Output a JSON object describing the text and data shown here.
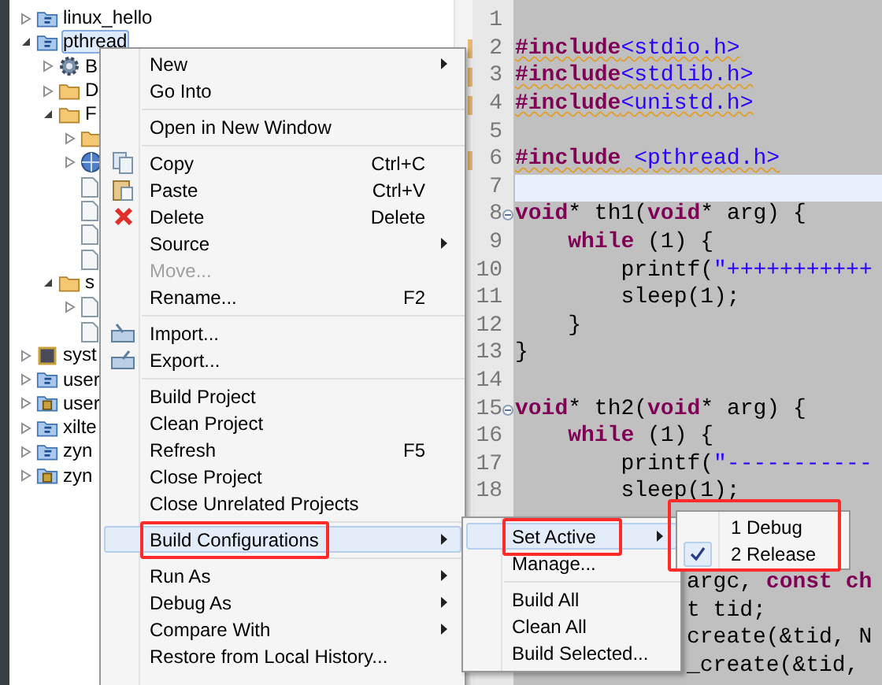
{
  "tree": [
    {
      "label": "linux_hello",
      "kind": "project",
      "expanded": false,
      "selected": false
    },
    {
      "label": "pthread",
      "kind": "project",
      "expanded": true,
      "selected": true,
      "children": [
        {
          "label": "B",
          "kind": "gear",
          "expanded": false,
          "selected": false
        },
        {
          "label": "D",
          "kind": "folder",
          "expanded": false,
          "selected": false
        },
        {
          "label": "F",
          "kind": "folder",
          "expanded": true,
          "selected": false,
          "children": [
            {
              "kind": "folder",
              "expanded": false,
              "selected": false
            },
            {
              "kind": "globe",
              "expanded": false,
              "selected": false
            },
            {
              "kind": "file",
              "selected": false
            },
            {
              "kind": "file",
              "selected": false
            },
            {
              "kind": "file",
              "selected": false
            },
            {
              "kind": "file",
              "selected": false
            }
          ]
        },
        {
          "label": "s",
          "kind": "folder",
          "expanded": true,
          "selected": false,
          "children": [
            {
              "kind": "file",
              "expanded": false,
              "selected": false
            },
            {
              "kind": "file",
              "selected": false
            }
          ]
        }
      ]
    },
    {
      "label": "syst",
      "kind": "chip",
      "expanded": false,
      "selected": false
    },
    {
      "label": "user",
      "kind": "project",
      "expanded": false,
      "selected": false
    },
    {
      "label": "user",
      "kind": "locked-project",
      "expanded": false,
      "selected": false
    },
    {
      "label": "xilte",
      "kind": "project",
      "expanded": false,
      "selected": false
    },
    {
      "label": "zyn",
      "kind": "project",
      "expanded": false,
      "selected": false
    },
    {
      "label": "zyn",
      "kind": "locked-project",
      "expanded": false,
      "selected": false
    }
  ],
  "editor": {
    "lines": [
      {
        "number": "1"
      },
      {
        "number": "2",
        "warning": true,
        "tokens": [
          {
            "text": "#include",
            "kind": "keyword"
          },
          {
            "text": "<stdio.h>",
            "kind": "string"
          }
        ]
      },
      {
        "number": "3",
        "warning": true,
        "tokens": [
          {
            "text": "#include",
            "kind": "keyword"
          },
          {
            "text": "<stdlib.h>",
            "kind": "string"
          }
        ]
      },
      {
        "number": "4",
        "warning": true,
        "tokens": [
          {
            "text": "#include",
            "kind": "keyword"
          },
          {
            "text": "<unistd.h>",
            "kind": "string"
          }
        ]
      },
      {
        "number": "5"
      },
      {
        "number": "6",
        "warning": true,
        "tokens": [
          {
            "text": "#include",
            "kind": "keyword"
          },
          {
            "text": " <pthread.h>",
            "kind": "string"
          }
        ]
      },
      {
        "number": "7",
        "current": true
      },
      {
        "number": "8",
        "foldable": true,
        "tokens": [
          {
            "text": "void",
            "kind": "keyword"
          },
          {
            "text": "* th1(",
            "kind": "plain"
          },
          {
            "text": "void",
            "kind": "keyword"
          },
          {
            "text": "* arg) {",
            "kind": "plain"
          }
        ]
      },
      {
        "number": "9",
        "tokens": [
          {
            "text": "    while",
            "kind": "keyword"
          },
          {
            "text": " (1) {",
            "kind": "plain"
          }
        ]
      },
      {
        "number": "10",
        "tokens": [
          {
            "text": "        printf(",
            "kind": "plain"
          },
          {
            "text": "\"+++++++++++",
            "kind": "string"
          }
        ]
      },
      {
        "number": "11",
        "tokens": [
          {
            "text": "        sleep(1);",
            "kind": "plain"
          }
        ]
      },
      {
        "number": "12",
        "tokens": [
          {
            "text": "    }",
            "kind": "plain"
          }
        ]
      },
      {
        "number": "13",
        "tokens": [
          {
            "text": "}",
            "kind": "plain"
          }
        ]
      },
      {
        "number": "14"
      },
      {
        "number": "15",
        "foldable": true,
        "tokens": [
          {
            "text": "void",
            "kind": "keyword"
          },
          {
            "text": "* th2(",
            "kind": "plain"
          },
          {
            "text": "void",
            "kind": "keyword"
          },
          {
            "text": "* arg) {",
            "kind": "plain"
          }
        ]
      },
      {
        "number": "16",
        "tokens": [
          {
            "text": "    while",
            "kind": "keyword"
          },
          {
            "text": " (1) {",
            "kind": "plain"
          }
        ]
      },
      {
        "number": "17",
        "tokens": [
          {
            "text": "        printf(",
            "kind": "plain"
          },
          {
            "text": "\"-----------",
            "kind": "string"
          }
        ]
      },
      {
        "number": "18",
        "tokens": [
          {
            "text": "        sleep(1);",
            "kind": "plain"
          }
        ]
      }
    ],
    "covered_lines": [
      {
        "tokens": [
          {
            "text": "argc, ",
            "kind": "plain"
          },
          {
            "text": "const",
            "kind": "keyword"
          },
          {
            "text": " ch",
            "kind": "keyword"
          }
        ]
      },
      {
        "tokens": [
          {
            "text": "t tid;",
            "kind": "plain"
          }
        ]
      },
      {
        "tokens": [
          {
            "text": "create(&tid, N",
            "kind": "plain"
          }
        ]
      },
      {
        "tokens": [
          {
            "text": "_create(&tid,",
            "kind": "plain"
          }
        ]
      }
    ]
  },
  "context_menu": [
    {
      "kind": "item",
      "label": "New",
      "submenu": true,
      "selected": false
    },
    {
      "kind": "item",
      "label": "Go Into",
      "selected": false
    },
    {
      "kind": "separator"
    },
    {
      "kind": "item",
      "label": "Open in New Window",
      "selected": false
    },
    {
      "kind": "separator"
    },
    {
      "kind": "copy",
      "label": "Copy",
      "shortcut": "Ctrl+C",
      "selected": false
    },
    {
      "kind": "paste",
      "label": "Paste",
      "shortcut": "Ctrl+V",
      "selected": false
    },
    {
      "kind": "delete",
      "label": "Delete",
      "shortcut": "Delete",
      "selected": false
    },
    {
      "kind": "item",
      "label": "Source",
      "submenu": true,
      "selected": false
    },
    {
      "kind": "item",
      "label": "Move...",
      "disabled": true,
      "selected": false
    },
    {
      "kind": "item",
      "label": "Rename...",
      "shortcut": "F2",
      "selected": false
    },
    {
      "kind": "separator"
    },
    {
      "kind": "import",
      "label": "Import...",
      "selected": false
    },
    {
      "kind": "export",
      "label": "Export...",
      "selected": false
    },
    {
      "kind": "separator"
    },
    {
      "kind": "item",
      "label": "Build Project",
      "selected": false
    },
    {
      "kind": "item",
      "label": "Clean Project",
      "selected": false
    },
    {
      "kind": "item",
      "label": "Refresh",
      "shortcut": "F5",
      "selected": false
    },
    {
      "kind": "item",
      "label": "Close Project",
      "selected": false
    },
    {
      "kind": "item",
      "label": "Close Unrelated Projects",
      "selected": false
    },
    {
      "kind": "separator"
    },
    {
      "kind": "item",
      "label": "Build Configurations",
      "submenu": true,
      "selected": true,
      "annotated": true
    },
    {
      "kind": "separator"
    },
    {
      "kind": "item",
      "label": "Run As",
      "submenu": true,
      "selected": false
    },
    {
      "kind": "item",
      "label": "Debug As",
      "submenu": true,
      "selected": false
    },
    {
      "kind": "item",
      "label": "Compare With",
      "submenu": true,
      "selected": false
    },
    {
      "kind": "item",
      "label": "Restore from Local History...",
      "selected": false
    }
  ],
  "build_configurations_menu": [
    {
      "kind": "item",
      "label": "Set Active",
      "submenu": true,
      "selected": true,
      "annotated": true
    },
    {
      "kind": "item",
      "label": "Manage...",
      "selected": false
    },
    {
      "kind": "separator"
    },
    {
      "kind": "item",
      "label": "Build All",
      "selected": false
    },
    {
      "kind": "item",
      "label": "Clean All",
      "selected": false
    },
    {
      "kind": "item",
      "label": "Build Selected...",
      "selected": false
    }
  ],
  "set_active_menu": {
    "annotated": true,
    "items": [
      {
        "label": "1 Debug",
        "checked": false
      },
      {
        "label": "2 Release",
        "checked": true
      }
    ]
  }
}
